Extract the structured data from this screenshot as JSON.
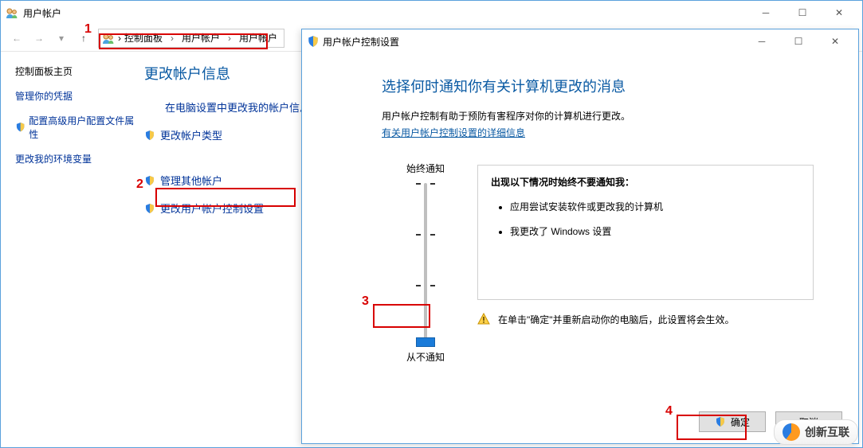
{
  "bg": {
    "title": "用户帐户",
    "breadcrumb": [
      "控制面板",
      "用户帐户",
      "用户帐户"
    ],
    "left": {
      "home": "控制面板主页",
      "creds": "管理你的凭据",
      "adv": "配置高级用户配置文件属性",
      "env": "更改我的环境变量"
    },
    "center": {
      "heading": "更改帐户信息",
      "link_pc_settings": "在电脑设置中更改我的帐户信息",
      "link_change_type": "更改帐户类型",
      "link_manage_other": "管理其他帐户",
      "link_change_uac": "更改用户帐户控制设置"
    }
  },
  "uac": {
    "title": "用户帐户控制设置",
    "heading": "选择何时通知你有关计算机更改的消息",
    "desc": "用户帐户控制有助于预防有害程序对你的计算机进行更改。",
    "help_link": "有关用户帐户控制设置的详细信息",
    "slider_top": "始终通知",
    "slider_bottom": "从不通知",
    "info_heading": "出现以下情况时始终不要通知我：",
    "info_items": [
      "应用尝试安装软件或更改我的计算机",
      "我更改了 Windows 设置"
    ],
    "warning": "在单击\"确定\"并重新启动你的电脑后，此设置将会生效。",
    "ok": "确定",
    "cancel": "取消"
  },
  "annotations": {
    "n1": "1",
    "n2": "2",
    "n3": "3",
    "n4": "4"
  },
  "watermark": "创新互联"
}
